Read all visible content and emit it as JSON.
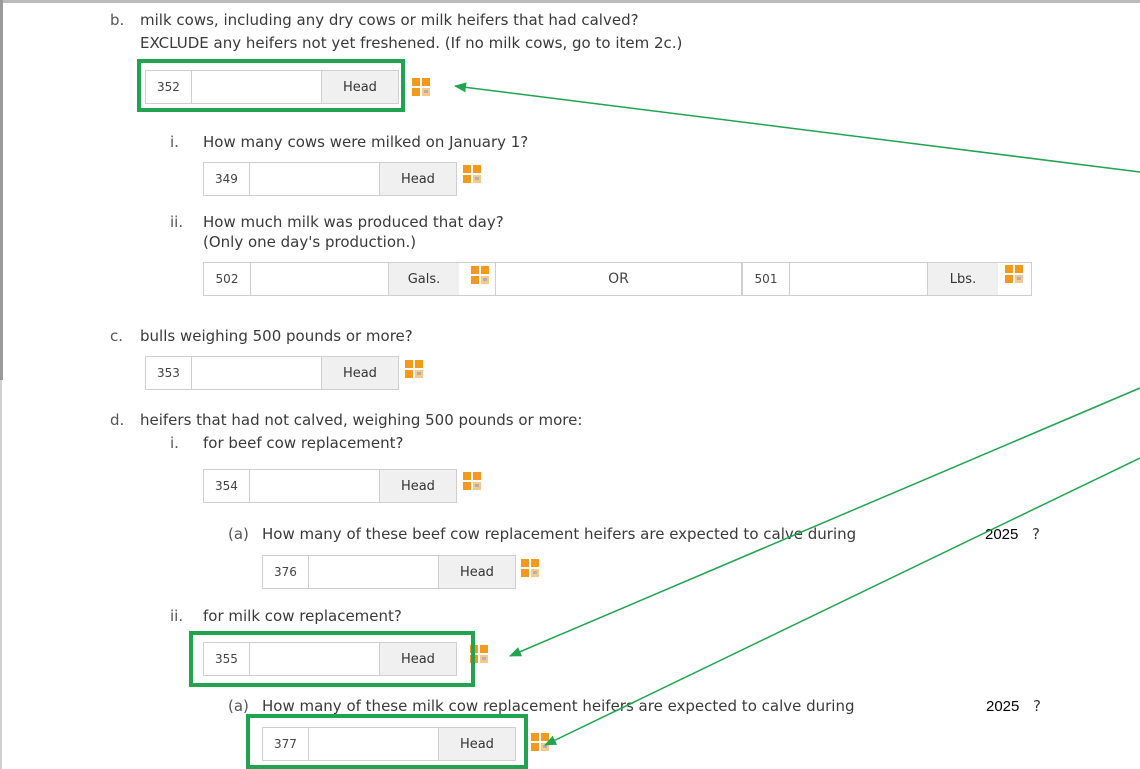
{
  "item_b": {
    "marker": "b.",
    "line1": "milk cows, including any dry cows or milk heifers that had calved?",
    "line2": "EXCLUDE any heifers not yet freshened.  (If no milk cows, go to item 2c.)",
    "field": {
      "code": "352",
      "value": "",
      "unit": "Head"
    },
    "sub_i": {
      "marker": "i.",
      "question": "How many cows were milked on January 1?",
      "field": {
        "code": "349",
        "value": "",
        "unit": "Head"
      }
    },
    "sub_ii": {
      "marker": "ii.",
      "question": "How much milk was produced that day?",
      "note": "(Only one day's production.)",
      "gals_field": {
        "code": "502",
        "value": "",
        "unit": "Gals."
      },
      "or_label": "OR",
      "lbs_field": {
        "code": "501",
        "value": "",
        "unit": "Lbs."
      }
    }
  },
  "item_c": {
    "marker": "c.",
    "question": "bulls weighing 500 pounds or more?",
    "field": {
      "code": "353",
      "value": "",
      "unit": "Head"
    }
  },
  "item_d": {
    "marker": "d.",
    "question": "heifers that had not calved, weighing 500 pounds or more:",
    "sub_i": {
      "marker": "i.",
      "question": "for beef cow replacement?",
      "field": {
        "code": "354",
        "value": "",
        "unit": "Head"
      },
      "sub_a": {
        "marker": "(a)",
        "question": "How many of these beef cow replacement heifers are expected to calve during",
        "year": "2025",
        "qmark": "?",
        "field": {
          "code": "376",
          "value": "",
          "unit": "Head"
        }
      }
    },
    "sub_ii": {
      "marker": "ii.",
      "question": "for milk cow replacement?",
      "field": {
        "code": "355",
        "value": "",
        "unit": "Head"
      },
      "sub_a": {
        "marker": "(a)",
        "question": "How many of these milk cow replacement heifers are expected to calve during",
        "year": "2025",
        "qmark": "?",
        "field": {
          "code": "377",
          "value": "",
          "unit": "Head"
        }
      }
    }
  },
  "colors": {
    "highlight": "#21a34f",
    "arrow": "#21a34f",
    "icon_orange": "#f39a1e"
  },
  "icon_name": "calculator-grid-icon"
}
